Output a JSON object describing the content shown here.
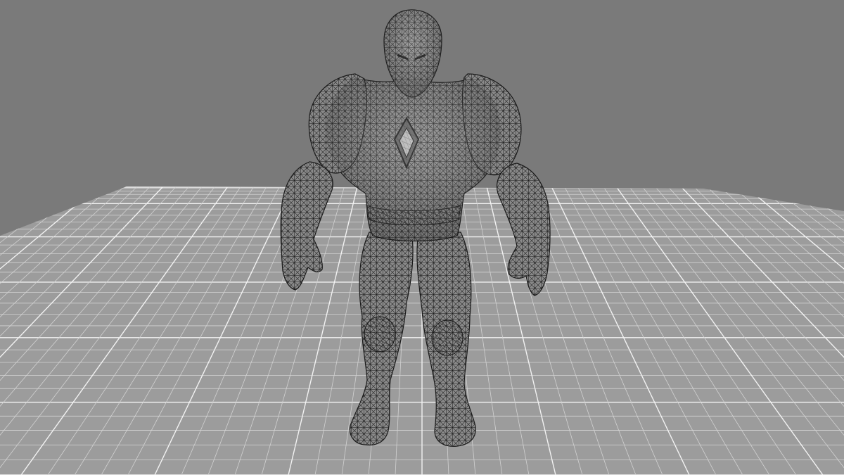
{
  "viewport": {
    "background_color": "#7a7a7a",
    "grid": {
      "visible": true,
      "plane_color": "#9c9c9c",
      "minor_line_color": "#d2d2d2",
      "major_line_color": "#f2f2f2"
    },
    "model": {
      "display_mode": "wireframe",
      "mesh_fill_color": "#8e8e8e",
      "mesh_line_color": "#1c1c1c"
    }
  }
}
